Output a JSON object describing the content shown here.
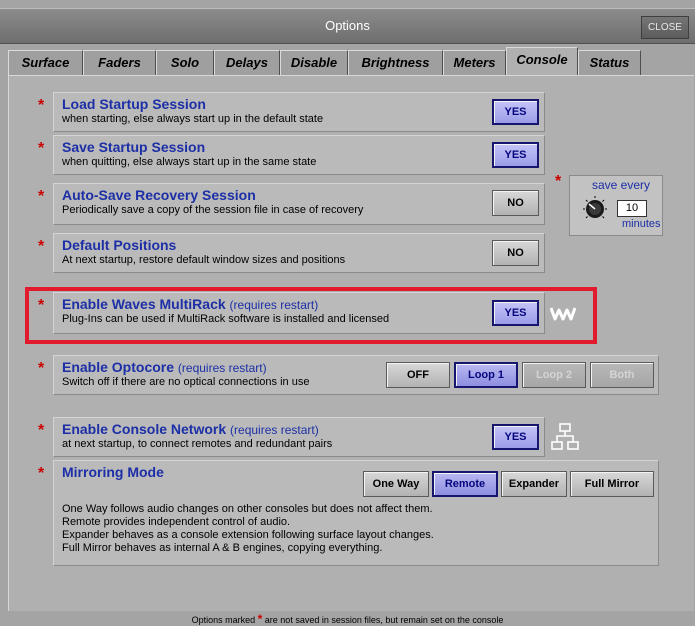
{
  "window": {
    "title": "Options",
    "close_label": "CLOSE"
  },
  "tabs": [
    "Surface",
    "Faders",
    "Solo",
    "Delays",
    "Disable",
    "Brightness",
    "Meters",
    "Console",
    "Status"
  ],
  "active_tab": "Console",
  "rows": {
    "load_startup": {
      "title": "Load Startup Session",
      "desc": "when starting, else always start up in the default state",
      "button": "YES",
      "state": "on"
    },
    "save_startup": {
      "title": "Save Startup Session",
      "desc": "when quitting, else always start up in the same state",
      "button": "YES",
      "state": "on"
    },
    "autosave": {
      "title": "Auto-Save Recovery Session",
      "desc": "Periodically save a copy of the session file in case of recovery",
      "button": "NO",
      "state": "off"
    },
    "default_positions": {
      "title": "Default Positions",
      "desc": "At next startup, restore default window sizes and positions",
      "button": "NO",
      "state": "off"
    },
    "multirack": {
      "title": "Enable Waves MultiRack",
      "note": "(requires restart)",
      "desc": "Plug-Ins can be used if MultiRack software is installed and licensed",
      "button": "YES",
      "state": "on"
    },
    "optocore": {
      "title": "Enable Optocore",
      "note": "(requires restart)",
      "desc": "Switch off if there are no optical connections in use",
      "options": [
        "OFF",
        "Loop 1",
        "Loop 2",
        "Both"
      ],
      "selected": "Loop 1"
    },
    "console_network": {
      "title": "Enable Console Network",
      "note": "(requires restart)",
      "desc": "at next startup, to connect remotes and redundant pairs",
      "button": "YES",
      "state": "on"
    },
    "mirroring": {
      "title": "Mirroring Mode",
      "options": [
        "One Way",
        "Remote",
        "Expander",
        "Full Mirror"
      ],
      "selected": "Remote",
      "desc_lines": [
        "One Way follows audio changes on other consoles but does not affect them.",
        "Remote provides independent control of audio.",
        "Expander behaves as a console extension following surface layout changes.",
        "Full Mirror behaves as internal A & B engines, copying everything."
      ]
    }
  },
  "autosave_interval": {
    "label": "save every",
    "value": "10",
    "unit": "minutes"
  },
  "asterisk": "*",
  "footer": {
    "before": "Options marked",
    "after": "are not saved in session files, but remain set on the console"
  },
  "icons": {
    "waves": "waves-logo-icon",
    "network": "network-icon",
    "knob": "knob-icon"
  },
  "colors": {
    "accent_red": "#e21b2c",
    "title_blue": "#1c2fa6",
    "button_on": "#9c9ce8"
  }
}
